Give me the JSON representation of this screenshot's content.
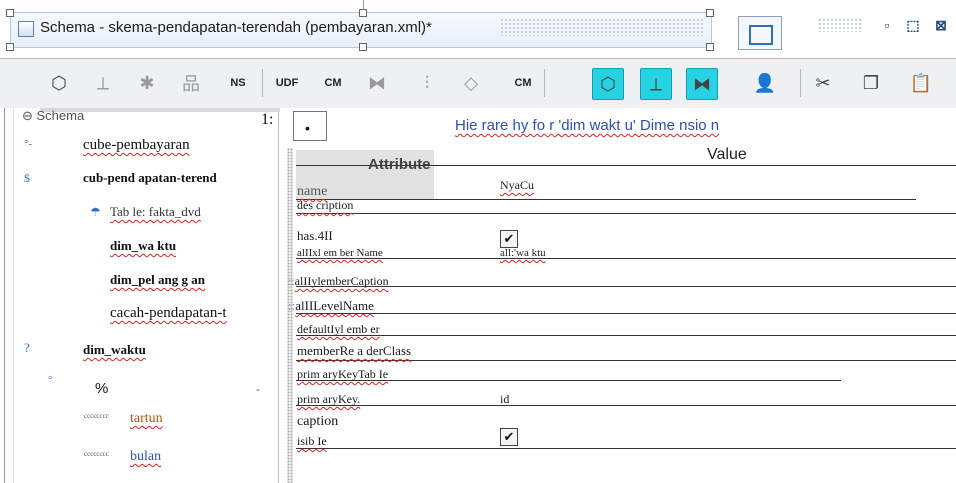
{
  "window": {
    "title": "Schema - skema-pendapatan-terendah (pembayaran.xml)*",
    "controls": {
      "restore": "▫",
      "maximize": "⬚",
      "close": "⊠"
    }
  },
  "toolbar": {
    "buttons": [
      {
        "name": "add-cube",
        "glyph": "⬡"
      },
      {
        "name": "add-measure",
        "glyph": "⟂"
      },
      {
        "name": "add-calculated-member",
        "glyph": "✱"
      },
      {
        "name": "add-dimension",
        "glyph": "品"
      },
      {
        "name": "add-named-set",
        "label": "NS"
      },
      {
        "name": "add-udf",
        "label": "UDF"
      },
      {
        "name": "add-cube-member",
        "label": "CM"
      },
      {
        "name": "add-link",
        "glyph": "⧓"
      },
      {
        "name": "add-level",
        "glyph": "⫶"
      },
      {
        "name": "add-property",
        "glyph": "◇"
      },
      {
        "name": "add-cm-property",
        "label": "CM"
      },
      {
        "name": "add-virtual-cube",
        "glyph": "⬡"
      },
      {
        "name": "add-virtual-measure",
        "glyph": "⟂"
      },
      {
        "name": "add-virtual-link",
        "glyph": "⧓"
      },
      {
        "name": "add-role",
        "glyph": "👤"
      },
      {
        "name": "cut",
        "glyph": "✂"
      },
      {
        "name": "copy",
        "glyph": "❐"
      },
      {
        "name": "paste",
        "glyph": "📋"
      }
    ]
  },
  "tree": {
    "root": "Schema",
    "corner": "1:",
    "items": [
      {
        "label": "cube-pembayaran",
        "marker": "°-"
      },
      {
        "label": "cub-pend apatan-terend",
        "marker": "$"
      },
      {
        "label": "Tab le: fakta_dvd",
        "marker": "☂"
      },
      {
        "label": "dim_wa ktu",
        "marker": ""
      },
      {
        "label": "dim_pel ang g an",
        "marker": ""
      },
      {
        "label": "cacah-pendapatan-t",
        "marker": ""
      },
      {
        "label": "dim_waktu",
        "marker": "?"
      },
      {
        "label": "%",
        "marker": "°"
      },
      {
        "label": "tartun",
        "marker": "cccccccc"
      },
      {
        "label": "bulan",
        "marker": "cccccccc"
      }
    ]
  },
  "editor": {
    "breadcrumb": "•",
    "title": "Hie rare hy fo r 'dim wakt u' Dime nsio n",
    "columns": {
      "attribute": "Attribute",
      "value": "Value"
    },
    "properties": [
      {
        "name": "name",
        "value": "NyaCu"
      },
      {
        "name": "des cription",
        "value": ""
      },
      {
        "name": "has.4II",
        "value": "",
        "checkbox": true,
        "checked": true
      },
      {
        "name": "alIIxl em ber Name",
        "value": "all:'wa ktu"
      },
      {
        "name": "alIIylemberCaption",
        "value": ""
      },
      {
        "name": "alIILevelName",
        "value": ""
      },
      {
        "name": "defaultIyl emb er",
        "value": ""
      },
      {
        "name": "memberRe a derClass",
        "value": ""
      },
      {
        "name": "prim aryKeyTab Ie",
        "value": ""
      },
      {
        "name": "prim aryKey.",
        "value": "id"
      },
      {
        "name": "caption",
        "value": ""
      },
      {
        "name": "isib Ie",
        "value": "",
        "checkbox": true,
        "checked": true
      }
    ]
  }
}
